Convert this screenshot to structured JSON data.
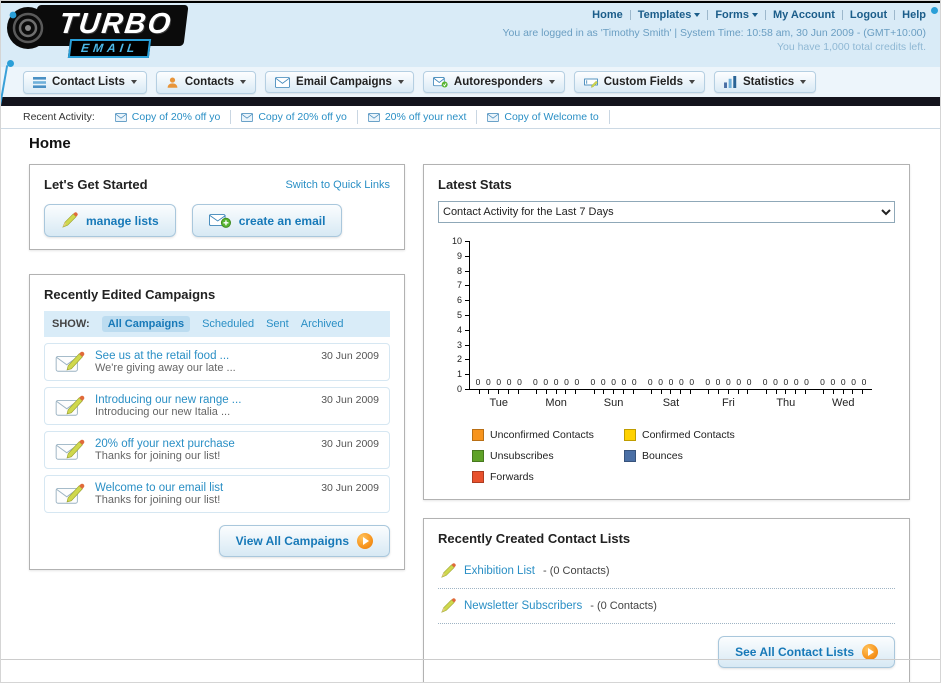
{
  "header": {
    "logo_title": "TURBO",
    "logo_subtitle": "EMAIL",
    "nav": [
      "Home",
      "Templates",
      "Forms",
      "My Account",
      "Logout",
      "Help"
    ],
    "login_line1": "You are logged in as 'Timothy Smith' | System Time: 10:58 am, 30 Jun 2009 - (GMT+10:00)",
    "login_line2": "You have 1,000 total credits left."
  },
  "tabs": [
    "Contact Lists",
    "Contacts",
    "Email Campaigns",
    "Autoresponders",
    "Custom Fields",
    "Statistics"
  ],
  "recent_activity": {
    "label": "Recent Activity:",
    "items": [
      "Copy of 20% off yo",
      "Copy of 20% off yo",
      "20% off your next",
      "Copy of Welcome to"
    ]
  },
  "page_title": "Home",
  "get_started": {
    "title": "Let's Get Started",
    "switch_link": "Switch to Quick Links",
    "manage_lists_label": "manage lists",
    "create_email_label": "create an email"
  },
  "campaigns": {
    "title": "Recently Edited Campaigns",
    "show_label": "SHOW:",
    "filters": [
      "All Campaigns",
      "Scheduled",
      "Sent",
      "Archived"
    ],
    "active_filter": "All Campaigns",
    "items": [
      {
        "title": "See us at the retail food ...",
        "subtitle": "We're giving away our late ...",
        "date": "30 Jun 2009"
      },
      {
        "title": "Introducing our new range ...",
        "subtitle": "Introducing our new Italia ...",
        "date": "30 Jun 2009"
      },
      {
        "title": "20% off your next purchase",
        "subtitle": "Thanks for joining our list!",
        "date": "30 Jun 2009"
      },
      {
        "title": "Welcome to our email list",
        "subtitle": "Thanks for joining our list!",
        "date": "30 Jun 2009"
      }
    ],
    "view_all_label": "View All Campaigns"
  },
  "stats": {
    "title": "Latest Stats",
    "selected_option": "Contact Activity for the Last 7 Days"
  },
  "chart_data": {
    "type": "bar",
    "title": "Contact Activity for the Last 7 Days",
    "categories": [
      "Tue",
      "Mon",
      "Sun",
      "Sat",
      "Fri",
      "Thu",
      "Wed"
    ],
    "series": [
      {
        "name": "Unconfirmed Contacts",
        "color": "#f7941d",
        "values": [
          0,
          0,
          0,
          0,
          0,
          0,
          0
        ]
      },
      {
        "name": "Confirmed Contacts",
        "color": "#ffd200",
        "values": [
          0,
          0,
          0,
          0,
          0,
          0,
          0
        ]
      },
      {
        "name": "Unsubscribes",
        "color": "#5fa228",
        "values": [
          0,
          0,
          0,
          0,
          0,
          0,
          0
        ]
      },
      {
        "name": "Bounces",
        "color": "#4a6fa5",
        "values": [
          0,
          0,
          0,
          0,
          0,
          0,
          0
        ]
      },
      {
        "name": "Forwards",
        "color": "#e8512d",
        "values": [
          0,
          0,
          0,
          0,
          0,
          0,
          0
        ]
      }
    ],
    "ylim": [
      0,
      10
    ],
    "yticks": [
      0,
      1,
      2,
      3,
      4,
      5,
      6,
      7,
      8,
      9,
      10
    ],
    "grid": false,
    "legend_position": "bottom"
  },
  "contact_lists": {
    "title": "Recently Created Contact Lists",
    "items": [
      {
        "name": "Exhibition List",
        "suffix": " - (0 Contacts)"
      },
      {
        "name": "Newsletter Subscribers",
        "suffix": " - (0 Contacts)"
      }
    ],
    "see_all_label": "See All Contact Lists"
  }
}
